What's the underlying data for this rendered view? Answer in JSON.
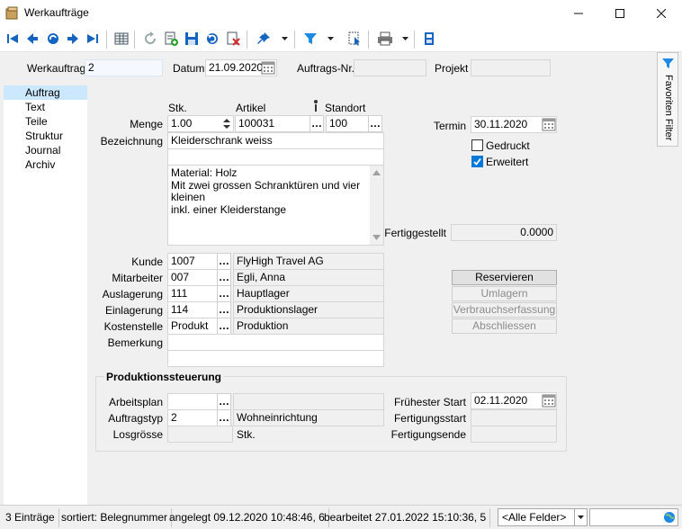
{
  "window": {
    "title": "Werkaufträge",
    "minimize": "—",
    "maximize": "☐",
    "close": "✕"
  },
  "toolbar": {
    "icons": [
      "first-icon",
      "prev-icon",
      "goto-icon",
      "next-icon",
      "last-icon",
      "table-icon",
      "refresh-icon",
      "new-icon",
      "save-icon",
      "undo-icon",
      "delete-icon",
      "pin-icon",
      "filter-icon",
      "select-icon",
      "print-icon",
      "view-icon"
    ]
  },
  "header": {
    "werkauftrag_label": "Werkauftrag",
    "werkauftrag_value": "2",
    "datum_label": "Datum",
    "datum_value": "21.09.2020",
    "auftragsnr_label": "Auftrags-Nr.",
    "auftragsnr_value": "",
    "projekt_label": "Projekt",
    "projekt_value": ""
  },
  "nav": {
    "items": [
      {
        "label": "Auftrag",
        "selected": true
      },
      {
        "label": "Text"
      },
      {
        "label": "Teile"
      },
      {
        "label": "Struktur"
      },
      {
        "label": "Journal"
      },
      {
        "label": "Archiv"
      }
    ]
  },
  "form": {
    "stk_label": "Stk.",
    "artikel_label": "Artikel",
    "standort_label": "Standort",
    "menge_label": "Menge",
    "menge_value": "1.00",
    "artikel_value": "100031",
    "standort_value": "100",
    "bezeichnung_label": "Bezeichnung",
    "bezeichnung_value": "Kleiderschrank weiss",
    "bezeichnung2_value": "",
    "memo_lines": [
      "Material: Holz",
      "Mit zwei grossen Schranktüren und vier",
      "kleinen",
      "inkl. einer Kleiderstange"
    ],
    "termin_label": "Termin",
    "termin_value": "30.11.2020",
    "gedruckt_label": "Gedruckt",
    "gedruckt_checked": false,
    "erweitert_label": "Erweitert",
    "erweitert_checked": true,
    "fertiggestellt_label": "Fertiggestellt",
    "fertiggestellt_value": "0.0000",
    "kunde_label": "Kunde",
    "kunde_value": "1007",
    "kunde_name": "FlyHigh Travel AG",
    "mitarbeiter_label": "Mitarbeiter",
    "mitarbeiter_value": "007",
    "mitarbeiter_name": "Egli, Anna",
    "auslagerung_label": "Auslagerung",
    "auslagerung_value": "111",
    "auslagerung_name": "Hauptlager",
    "einlagerung_label": "Einlagerung",
    "einlagerung_value": "114",
    "einlagerung_name": "Produktionslager",
    "kostenstelle_label": "Kostenstelle",
    "kostenstelle_value": "Produkt",
    "kostenstelle_name": "Produktion",
    "bemerkung_label": "Bemerkung",
    "bemerkung_value": "",
    "bemerkung2_value": ""
  },
  "actions": {
    "reservieren": "Reservieren",
    "umlagern": "Umlagern",
    "verbrauchserfassung": "Verbrauchserfassung",
    "abschliessen": "Abschliessen"
  },
  "produktion": {
    "title": "Produktionssteuerung",
    "arbeitsplan_label": "Arbeitsplan",
    "arbeitsplan_value": "",
    "arbeitsplan_name": "",
    "auftragstyp_label": "Auftragstyp",
    "auftragstyp_value": "2",
    "auftragstyp_name": "Wohneinrichtung",
    "losgroesse_label": "Losgrösse",
    "losgroesse_value": "",
    "losgroesse_unit": "Stk.",
    "fruehester_start_label": "Frühester Start",
    "fruehester_start_value": "02.11.2020",
    "fertigungsstart_label": "Fertigungsstart",
    "fertigungsstart_value": "",
    "fertigungsende_label": "Fertigungsende",
    "fertigungsende_value": ""
  },
  "sidetab": {
    "label": "Favoriten Filter"
  },
  "status": {
    "count": "3 Einträge",
    "sort": "sortiert: Belegnummer",
    "created": "angelegt 09.12.2020 10:48:46,  6",
    "edited": "bearbeitet 27.01.2022 15:10:36,  5",
    "field_select": "<Alle Felder>",
    "search": ""
  },
  "colors": {
    "accent": "#0078d7",
    "selection": "#cce8ff",
    "panel": "#f0f0f0"
  }
}
